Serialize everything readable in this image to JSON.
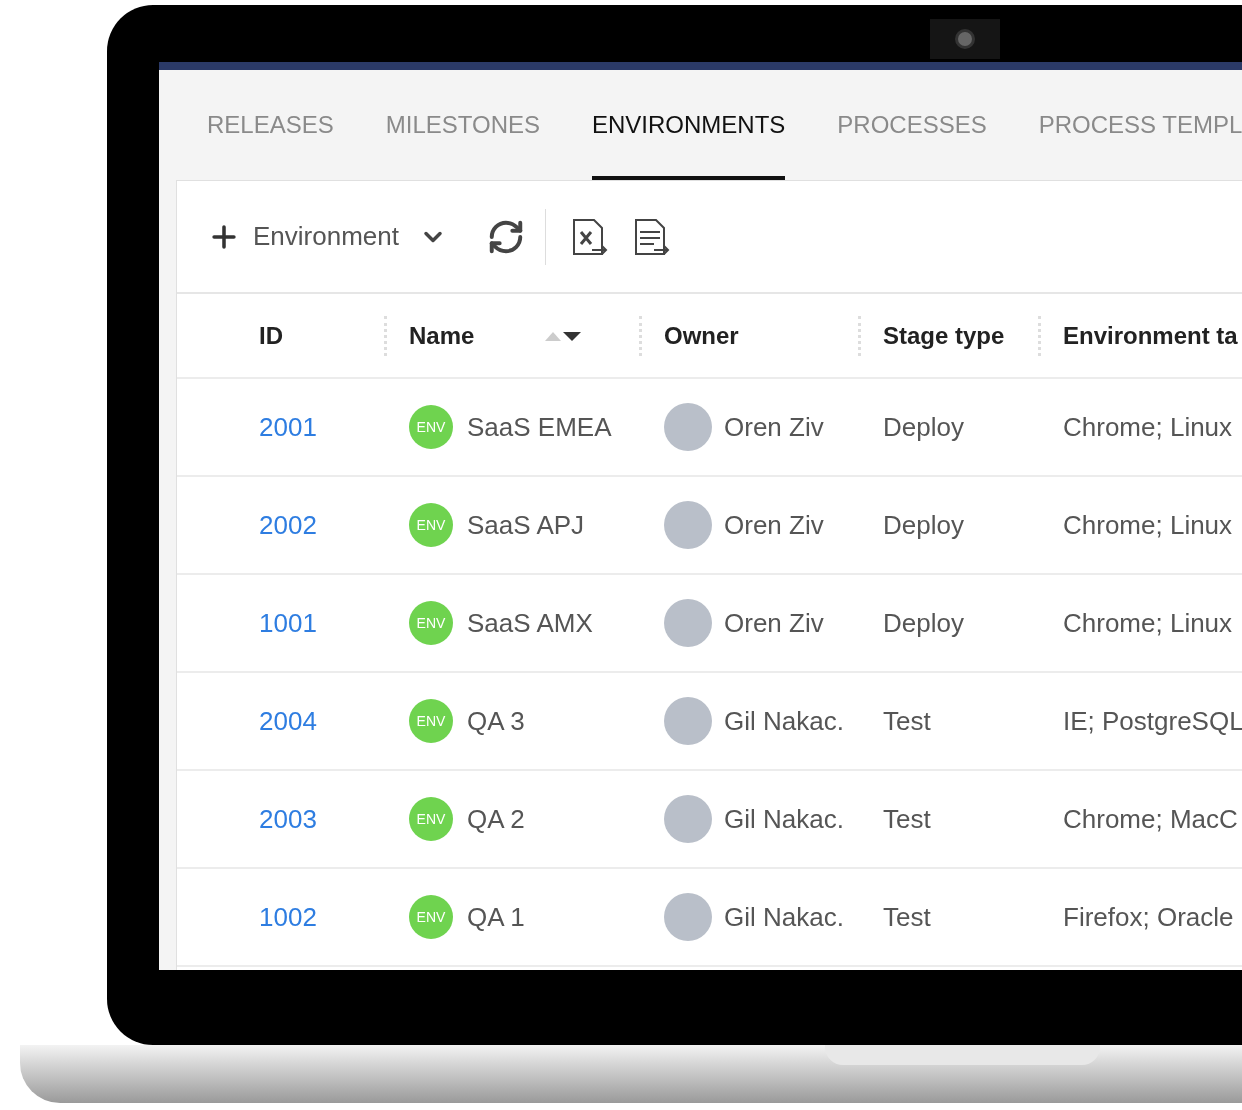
{
  "tabs": [
    {
      "label": "RELEASES",
      "selected": false
    },
    {
      "label": "MILESTONES",
      "selected": false
    },
    {
      "label": "ENVIRONMENTS",
      "selected": true
    },
    {
      "label": "PROCESSES",
      "selected": false
    },
    {
      "label": "PROCESS TEMPL",
      "selected": false
    }
  ],
  "toolbar": {
    "add_label": "Environment"
  },
  "table": {
    "columns": [
      {
        "label": "ID",
        "sorted": false
      },
      {
        "label": "Name",
        "sorted": true
      },
      {
        "label": "Owner",
        "sorted": false
      },
      {
        "label": "Stage type",
        "sorted": false
      },
      {
        "label": "Environment ta",
        "sorted": false
      }
    ],
    "rows": [
      {
        "id": "2001",
        "badge": "ENV",
        "name": "SaaS EMEA",
        "owner": "Oren Ziv",
        "stage_type": "Deploy",
        "tags": "Chrome; Linux"
      },
      {
        "id": "2002",
        "badge": "ENV",
        "name": "SaaS APJ",
        "owner": "Oren Ziv",
        "stage_type": "Deploy",
        "tags": "Chrome; Linux"
      },
      {
        "id": "1001",
        "badge": "ENV",
        "name": "SaaS AMX",
        "owner": "Oren Ziv",
        "stage_type": "Deploy",
        "tags": "Chrome; Linux"
      },
      {
        "id": "2004",
        "badge": "ENV",
        "name": "QA 3",
        "owner": "Gil Nakac.",
        "stage_type": "Test",
        "tags": "IE; PostgreSQL"
      },
      {
        "id": "2003",
        "badge": "ENV",
        "name": "QA 2",
        "owner": "Gil Nakac.",
        "stage_type": "Test",
        "tags": "Chrome; MacC"
      },
      {
        "id": "1002",
        "badge": "ENV",
        "name": "QA 1",
        "owner": "Gil Nakac.",
        "stage_type": "Test",
        "tags": "Firefox; Oracle"
      }
    ]
  }
}
